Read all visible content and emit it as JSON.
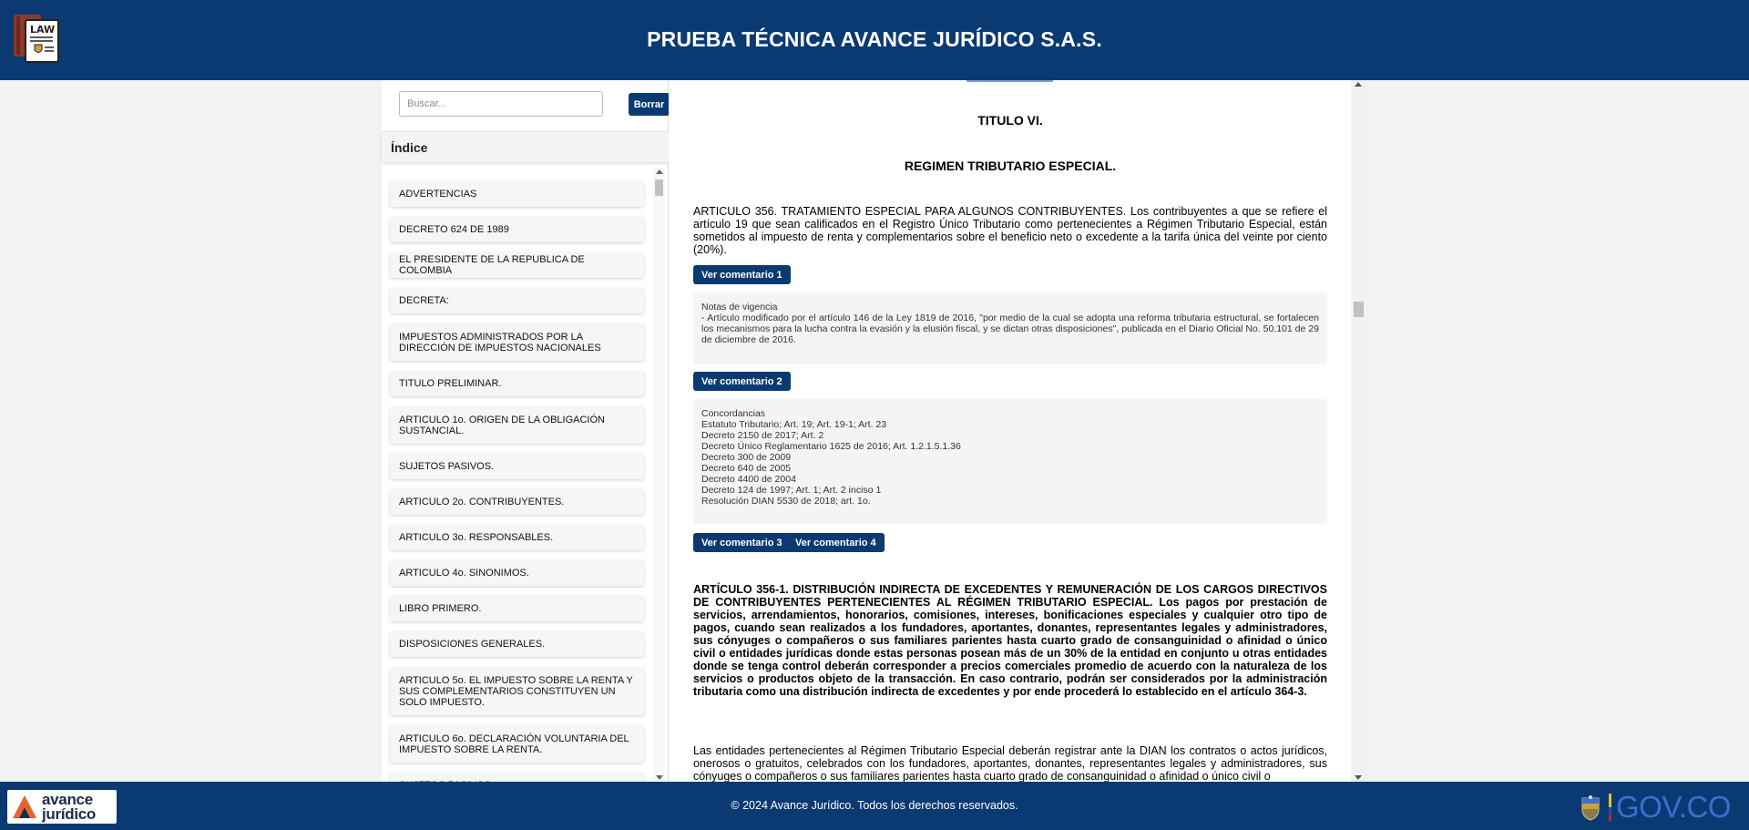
{
  "header": {
    "title": "PRUEBA TÉCNICA AVANCE JURÍDICO S.A.S.",
    "logo_text": "LAW"
  },
  "sidebar": {
    "search_placeholder": "Buscar...",
    "clear_label": "Borrar",
    "index_title": "Índice",
    "items": [
      "ADVERTENCIAS",
      "DECRETO 624 DE 1989",
      "EL PRESIDENTE DE LA REPUBLICA DE COLOMBIA",
      "DECRETA:",
      "IMPUESTOS ADMINISTRADOS POR LA DIRECCIÓN DE IMPUESTOS NACIONALES",
      "TITULO PRELIMINAR.",
      "ARTICULO 1o. ORIGEN DE LA OBLIGACIÓN SUSTANCIAL.",
      "SUJETOS PASIVOS.",
      "ARTICULO 2o. CONTRIBUYENTES.",
      "ARTICULO 3o. RESPONSABLES.",
      "ARTICULO 4o. SINONIMOS.",
      "LIBRO PRIMERO.",
      "DISPOSICIONES GENERALES.",
      "ARTICULO 5o. EL IMPUESTO SOBRE LA RENTA Y SUS COMPLEMENTARIOS CONSTITUYEN UN SOLO IMPUESTO.",
      "ARTICULO 6o. DECLARACIÓN VOLUNTARIA DEL IMPUESTO SOBRE LA RENTA.",
      "SUJETOS PASIVOS."
    ]
  },
  "main": {
    "title_1": "TITULO VI.",
    "title_2": "REGIMEN TRIBUTARIO ESPECIAL.",
    "art356_text": "ARTICULO 356. TRATAMIENTO ESPECIAL PARA ALGUNOS CONTRIBUYENTES. Los contribuyentes a que se refiere el artículo 19 que sean calificados en el Registro Único Tributario como pertenecientes a Régimen Tributario Especial, están sometidos al impuesto de renta y complementarios sobre el beneficio neto o excedente a la tarifa única del veinte por ciento (20%).",
    "comment_1": "Ver comentario 1",
    "comment_2": "Ver comentario 2",
    "comment_3": "Ver comentario 3",
    "comment_4": "Ver comentario 4",
    "notas_title": "Notas de vigencia",
    "notas_text": "- Artículo modificado por el artículo 146 de la Ley 1819 de 2016, \"por medio de la cual se adopta una reforma tributaria estructural, se fortalecen los mecanismos para la lucha contra la evasión y la elusión fiscal, y se dictan otras disposiciones\", publicada en el Diario Oficial No. 50.101 de 29 de diciembre de 2016.",
    "concordancias": [
      "Concordancias",
      "Estatuto Tributario; Art. 19; Art. 19-1; Art. 23",
      "Decreto 2150 de 2017; Art. 2",
      "Decreto Único Reglamentario 1625 de 2016; Art. 1.2.1.5.1.36",
      "Decreto 300 de 2009",
      "Decreto 640 de 2005",
      "Decreto 4400 de 2004",
      "Decreto 124 de 1997; Art. 1; Art. 2 inciso 1",
      "Resolución DIAN 5530 de 2018; art. 1o."
    ],
    "art3561_text": "ARTÍCULO 356-1. DISTRIBUCIÓN INDIRECTA DE EXCEDENTES Y REMUNERACIÓN DE LOS CARGOS DIRECTIVOS DE CONTRIBUYENTES PERTENECIENTES AL RÉGIMEN TRIBUTARIO ESPECIAL. Los pagos por prestación de servicios, arrendamientos, honorarios, comisiones, intereses, bonificaciones especiales y cualquier otro tipo de pagos, cuando sean realizados a los fundadores, aportantes, donantes, representantes legales y administradores, sus cónyuges o compañeros o sus familiares parientes hasta cuarto grado de consanguinidad o afinidad o único civil o entidades jurídicas donde estas personas posean más de un 30% de la entidad en conjunto u otras entidades donde se tenga control deberán corresponder a precios comerciales promedio de acuerdo con la naturaleza de los servicios o productos objeto de la transacción. En caso contrario, podrán ser considerados por la administración tributaria como una distribución indirecta de excedentes y por ende procederá lo establecido en el artículo 364-3.",
    "art3561_p2": "Las entidades pertenecientes al Régimen Tributario Especial deberán registrar ante la DIAN los contratos o actos jurídicos, onerosos o gratuitos, celebrados con los fundadores, aportantes, donantes, representantes legales y administradores, sus cónyuges o compañeros o sus familiares parientes hasta cuarto grado de consanguinidad o afinidad o único civil o"
  },
  "footer": {
    "logo_line1": "avance",
    "logo_line2": "jurídico",
    "copyright": "© 2024 Avance Jurídico. Todos los derechos reservados.",
    "gov_text": "GOV.CO"
  },
  "colors": {
    "brand_blue": "#0b3a73",
    "gov_blue": "#3b6fd1",
    "logo_orange": "#e8622a"
  }
}
